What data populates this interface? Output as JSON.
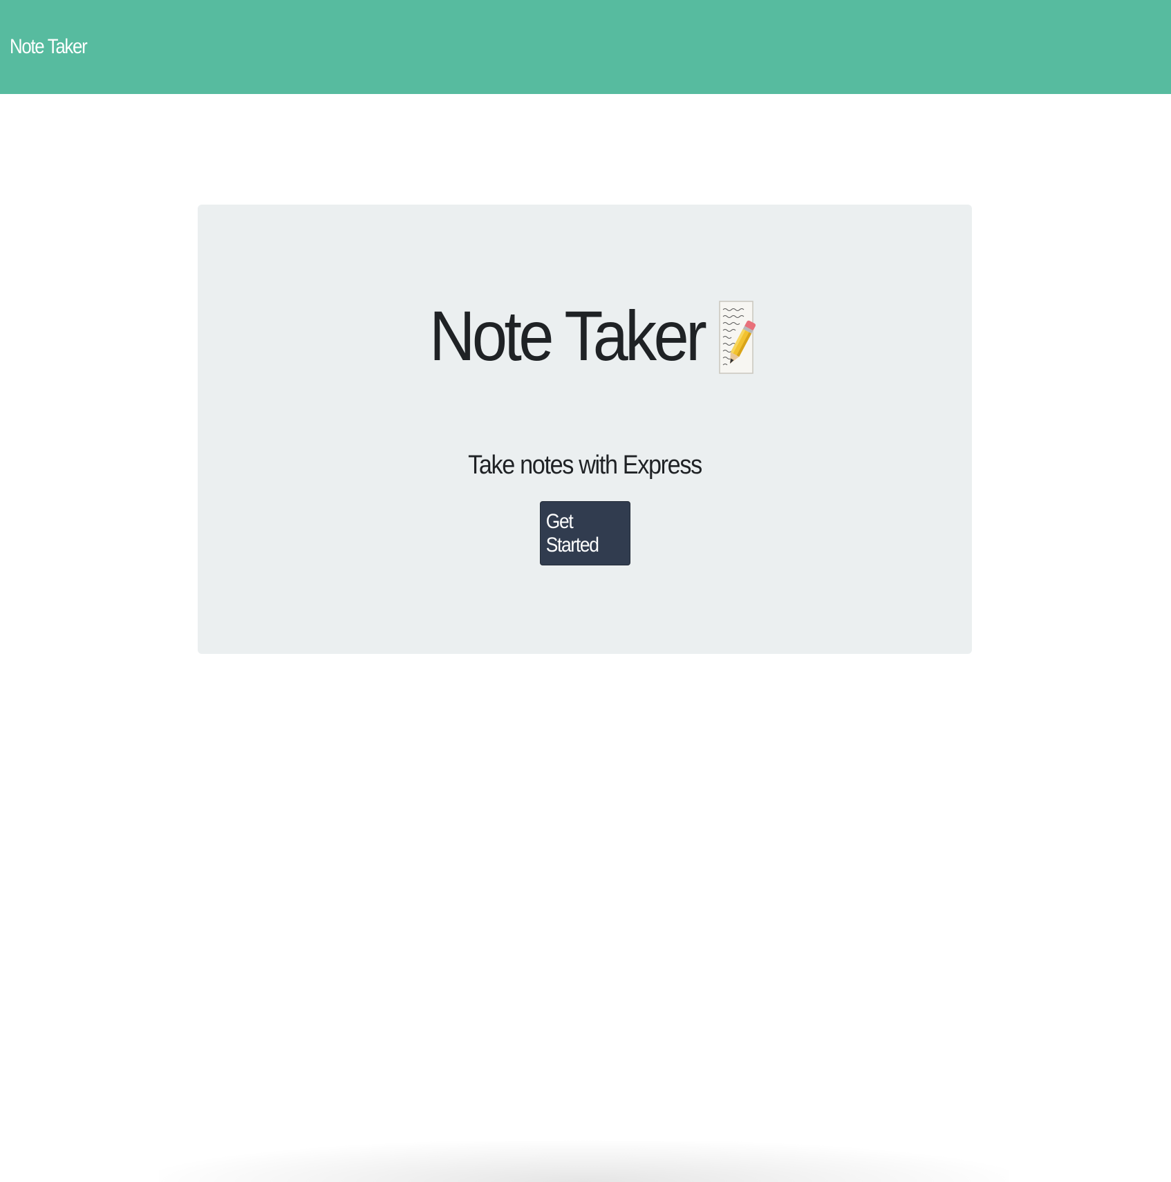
{
  "navbar": {
    "brand": "Note Taker"
  },
  "hero": {
    "title": "Note Taker",
    "title_icon": "memo-icon",
    "subtitle": "Take notes with Express",
    "cta_label": "Get Started"
  },
  "colors": {
    "navbar_bg": "#57bb9f",
    "jumbotron_bg": "#ebeff0",
    "button_bg": "#313c4f",
    "text": "#1f2225"
  }
}
